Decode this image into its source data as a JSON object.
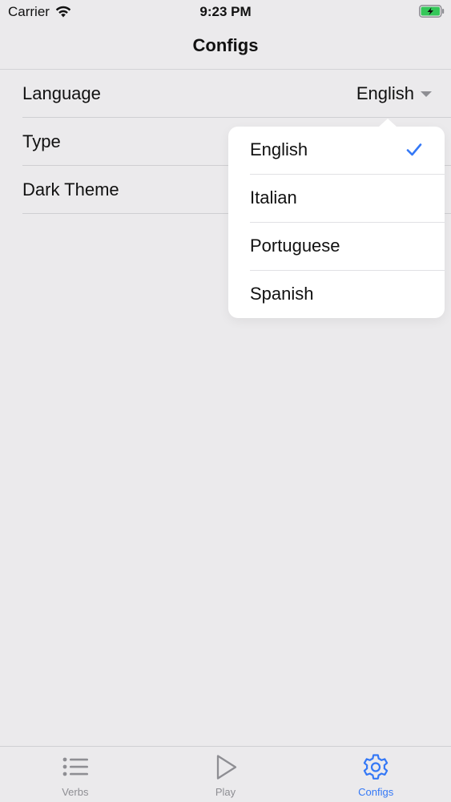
{
  "status_bar": {
    "carrier": "Carrier",
    "time": "9:23 PM",
    "wifi_icon": "wifi-icon",
    "battery_icon": "battery-charging-icon"
  },
  "nav": {
    "title": "Configs"
  },
  "settings": {
    "language_label": "Language",
    "language_value": "English",
    "type_label": "Type",
    "dark_theme_label": "Dark Theme"
  },
  "dropdown": {
    "options": [
      "English",
      "Italian",
      "Portuguese",
      "Spanish"
    ],
    "selected": "English"
  },
  "tabs": [
    {
      "label": "Verbs",
      "icon": "list-icon",
      "active": false
    },
    {
      "label": "Play",
      "icon": "play-icon",
      "active": false
    },
    {
      "label": "Configs",
      "icon": "gear-icon",
      "active": true
    }
  ],
  "colors": {
    "accent": "#3478f6",
    "background": "#ebeaec",
    "inactive": "#8e8e93",
    "battery": "#34c759"
  }
}
